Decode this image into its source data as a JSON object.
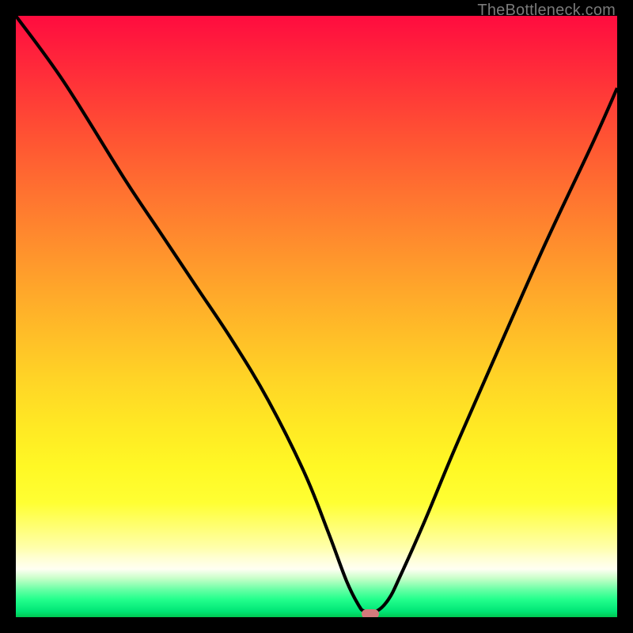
{
  "watermark": "TheBottleneck.com",
  "colors": {
    "curve_stroke": "#000000",
    "marker_fill": "#d47a7c",
    "frame_bg": "#000000"
  },
  "chart_data": {
    "type": "line",
    "title": "",
    "xlabel": "",
    "ylabel": "",
    "xlim": [
      0,
      100
    ],
    "ylim": [
      0,
      100
    ],
    "grid": false,
    "legend": false,
    "series": [
      {
        "name": "bottleneck-curve",
        "x": [
          0,
          8,
          18,
          24,
          30,
          36,
          42,
          48,
          52,
          55,
          57,
          58,
          60,
          62,
          64,
          68,
          73,
          80,
          88,
          96,
          100
        ],
        "values": [
          100,
          89,
          73,
          64,
          55,
          46,
          36,
          24,
          14,
          6,
          2,
          1,
          1,
          3,
          7,
          16,
          28,
          44,
          62,
          79,
          88
        ]
      }
    ],
    "annotations": [
      {
        "name": "minimum-marker",
        "x": 59,
        "y": 0.5
      }
    ]
  }
}
